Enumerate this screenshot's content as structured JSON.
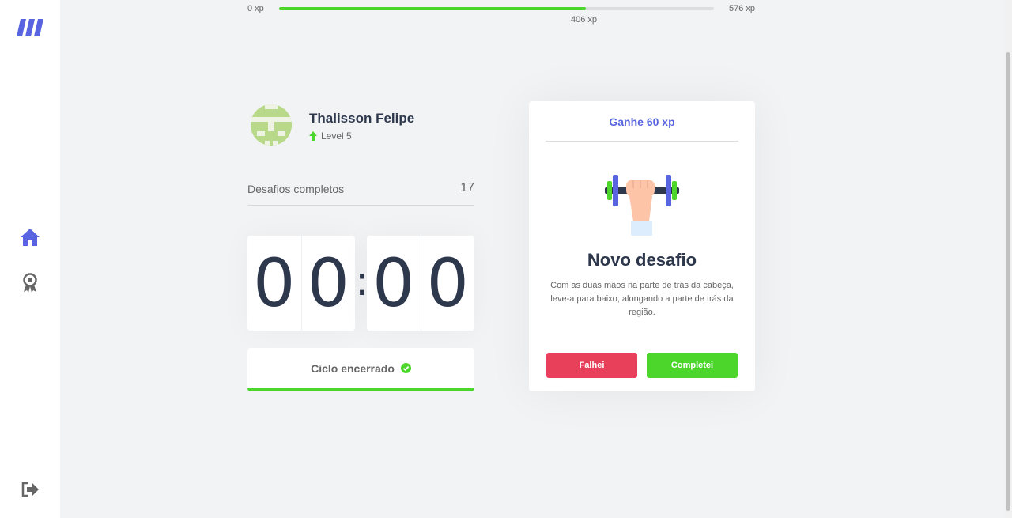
{
  "xp": {
    "min_label": "0 xp",
    "max_label": "576 xp",
    "current_label": "406 xp",
    "current": 406,
    "max": 576
  },
  "profile": {
    "name": "Thalisson Felipe",
    "level_label": "Level 5"
  },
  "stats": {
    "completed_label": "Desafios completos",
    "completed_value": "17"
  },
  "countdown": {
    "minute_left": "0",
    "minute_right": "0",
    "separator": ":",
    "second_left": "0",
    "second_right": "0"
  },
  "cycle": {
    "label": "Ciclo encerrado"
  },
  "challenge": {
    "header": "Ganhe 60 xp",
    "title": "Novo desafio",
    "description": "Com as duas mãos na parte de trás da cabeça, leve-a para baixo, alongando a parte de trás da região.",
    "fail_label": "Falhei",
    "complete_label": "Completei"
  },
  "colors": {
    "accent": "#5965e0",
    "success": "#4cd62b",
    "danger": "#e83f5b",
    "title": "#2e384d",
    "text": "#666666",
    "background": "#f2f3f5"
  },
  "icons": {
    "logo": "moveit-logo",
    "home": "home-icon",
    "award": "award-icon",
    "logout": "logout-icon",
    "level": "level-up-arrow-icon",
    "cycle": "check-circle-icon",
    "challenge": "body-dumbbell-icon"
  }
}
